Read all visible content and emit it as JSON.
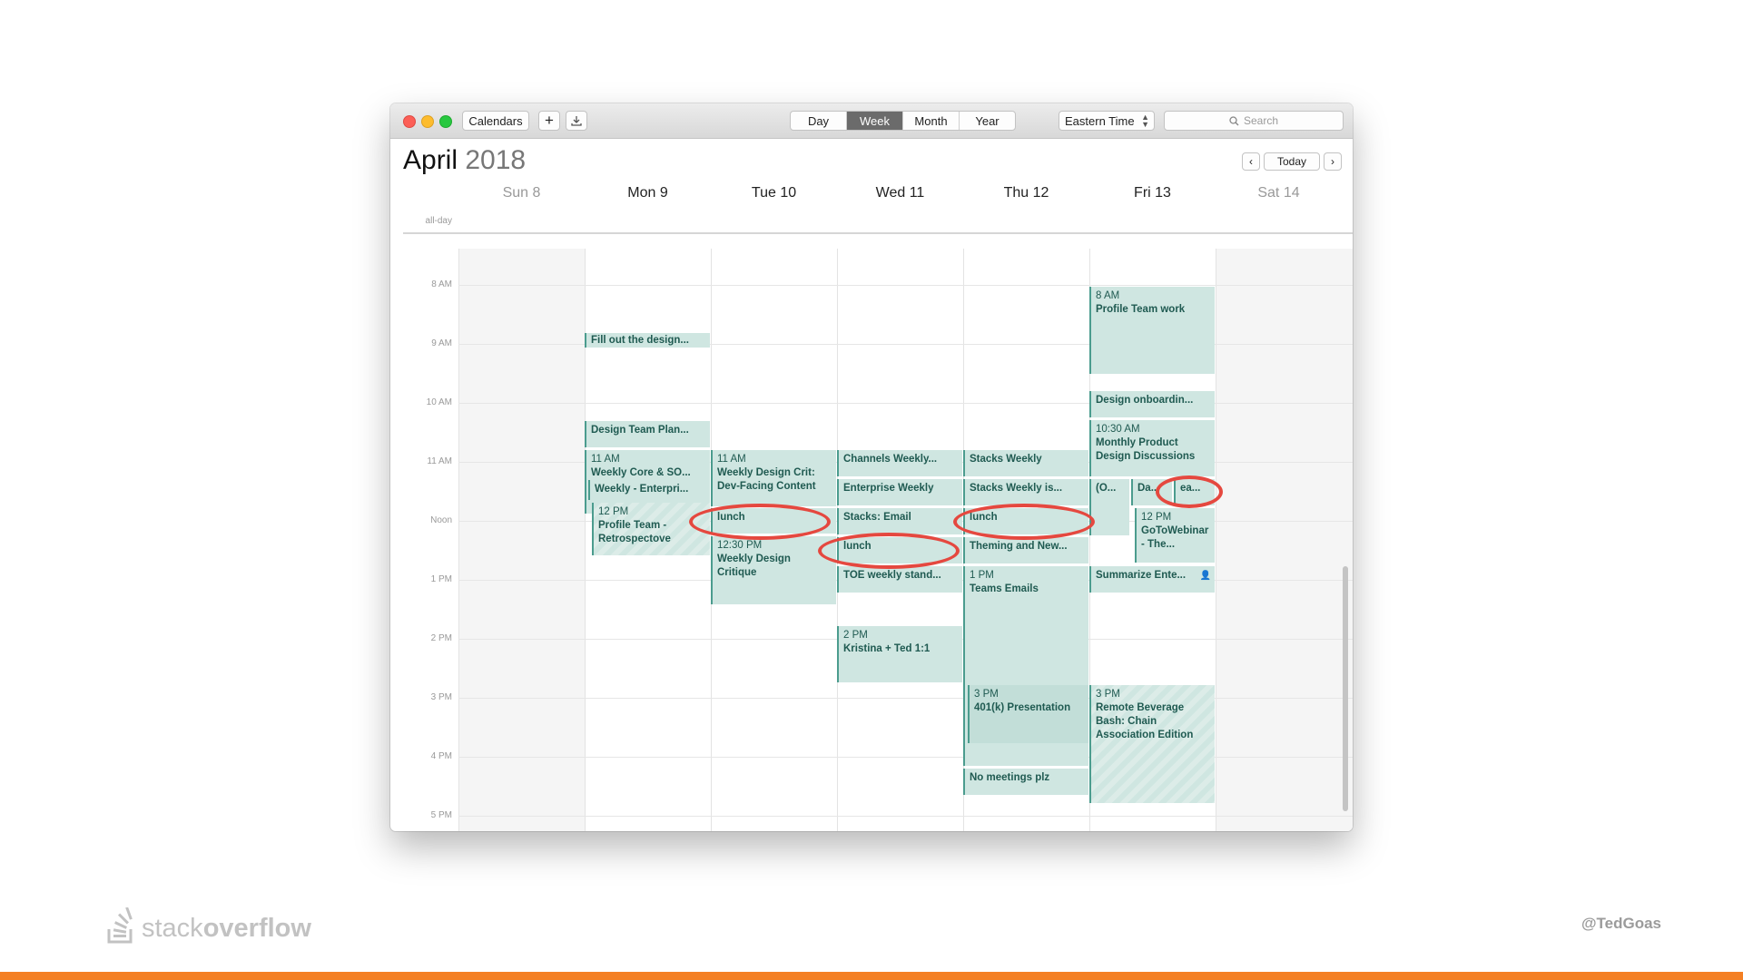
{
  "toolbar": {
    "calendars_label": "Calendars",
    "add_label": "+",
    "views": [
      "Day",
      "Week",
      "Month",
      "Year"
    ],
    "active_view": "Week",
    "timezone": "Eastern Time",
    "search_placeholder": "Search"
  },
  "header": {
    "month": "April",
    "year": "2018",
    "today_label": "Today",
    "days": [
      "Sun 8",
      "Mon 9",
      "Tue 10",
      "Wed 11",
      "Thu 12",
      "Fri 13",
      "Sat 14"
    ],
    "allday_label": "all-day"
  },
  "hours": [
    "8 AM",
    "9 AM",
    "10 AM",
    "11 AM",
    "Noon",
    "1 PM",
    "2 PM",
    "3 PM",
    "4 PM",
    "5 PM"
  ],
  "events": {
    "mon_fill": "Fill out the design...",
    "mon_dtp": "Design Team Plan...",
    "mon_core_time": "11 AM",
    "mon_core": "Weekly Core & SO...",
    "mon_enterprise": "Weekly - Enterpri...",
    "mon_profile_time": "12 PM",
    "mon_profile": "Profile Team - Retrospectove",
    "tue_crit_time": "11 AM",
    "tue_crit": "Weekly Design Crit: Dev-Facing Content",
    "tue_lunch": "lunch",
    "tue_critique_time": "12:30 PM",
    "tue_critique": "Weekly Design Critique",
    "wed_channels": "Channels Weekly...",
    "wed_enterprise": "Enterprise Weekly",
    "wed_stacks_email": "Stacks: Email",
    "wed_lunch": "lunch",
    "wed_toe": "TOE weekly stand...",
    "wed_kt_time": "2 PM",
    "wed_kt": "Kristina + Ted 1:1",
    "thu_stacks": "Stacks Weekly",
    "thu_stacks_is": "Stacks Weekly is...",
    "thu_lunch": "lunch",
    "thu_theming": "Theming and New...",
    "thu_teams_time": "1 PM",
    "thu_teams": "Teams Emails",
    "thu_401k_time": "3 PM",
    "thu_401k": "401(k) Presentation",
    "thu_nomeet": "No meetings plz",
    "fri_profile_time": "8 AM",
    "fri_profile": "Profile Team work",
    "fri_onboard": "Design onboardin...",
    "fri_monthly_time": "10:30 AM",
    "fri_monthly": "Monthly Product Design Discussions",
    "fri_o": "(O...",
    "fri_da": "Da...",
    "fri_ea": "ea...",
    "fri_goto_time": "12 PM",
    "fri_goto": "GoToWebinar - The...",
    "fri_summarize": "Summarize Ente...",
    "fri_remote_time": "3 PM",
    "fri_remote": "Remote Beverage Bash: Chain Association Edition"
  },
  "footer": {
    "logo_light": "stack",
    "logo_bold": "overflow",
    "handle": "@TedGoas"
  },
  "colors": {
    "event_fill": "#cfe6e1",
    "event_border": "#4b9c8e",
    "highlight_circle": "#e5483f",
    "brand_orange": "#f48024"
  }
}
